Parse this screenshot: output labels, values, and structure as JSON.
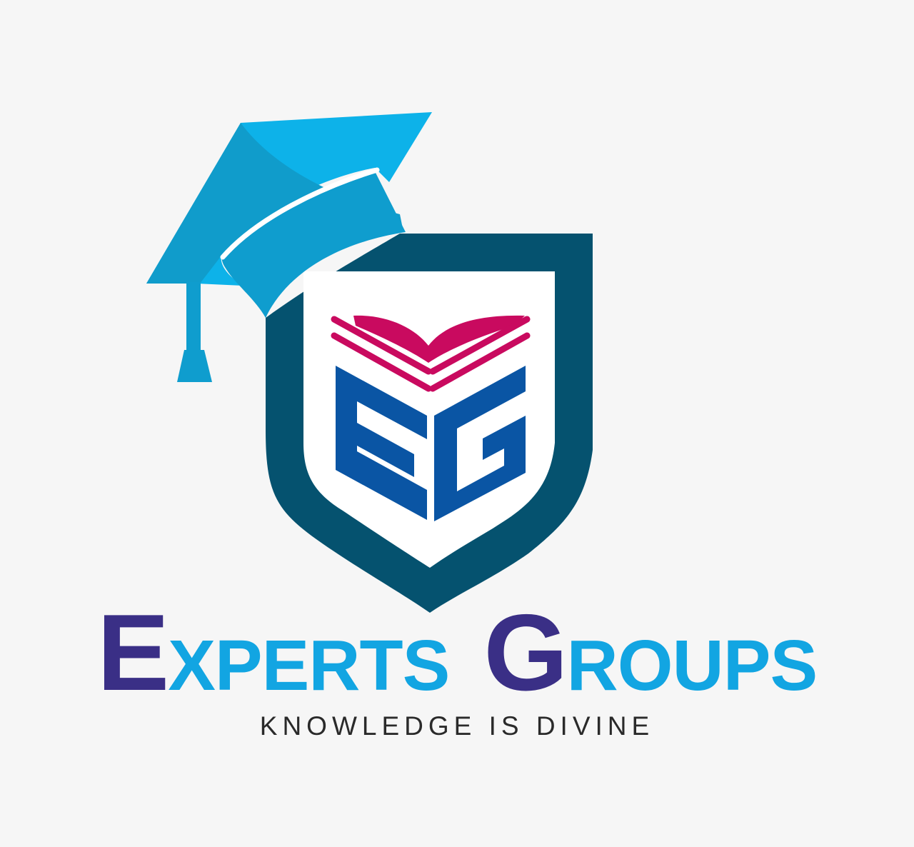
{
  "logo": {
    "monogram": "EG",
    "name": {
      "word1_initial": "E",
      "word1_rest": "XPERTS",
      "word2_initial": "G",
      "word2_rest": "ROUPS"
    },
    "tagline": "KNOWLEDGE IS DIVINE"
  },
  "colors": {
    "background": "#f6f6f6",
    "cap_top": "#0db2e9",
    "cap_shade": "#109ccb",
    "cap_band": "#0f9dce",
    "shield_dark": "#05526f",
    "shield_inner": "#ffffff",
    "book": "#c90a5f",
    "monogram": "#0a55a4",
    "name_initials": "#3a2f86",
    "name_rest": "#12a5e2",
    "tagline": "#2a2a2a"
  },
  "icons": {
    "cap": "graduation-cap-icon",
    "shield": "shield-icon",
    "book": "open-book-icon"
  }
}
